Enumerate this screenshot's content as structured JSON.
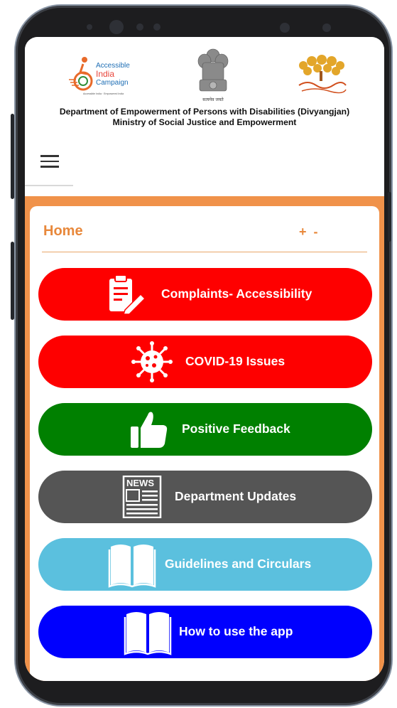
{
  "header": {
    "left_logo_lines": [
      "Accessible",
      "India",
      "Campaign"
    ],
    "left_logo_tagline": "Accessible India · Empowered India",
    "emblem_motto": "सत्यमेव जयते",
    "dept_line1": "Department of Empowerment of Persons with Disabilities (Divyangjan)",
    "dept_line2": "Ministry of Social Justice and Empowerment"
  },
  "home": {
    "title": "Home",
    "zoom_in": "+",
    "zoom_out": "-"
  },
  "menu": [
    {
      "label": "Complaints- Accessibility",
      "color": "#fe0000",
      "icon": "clipboard-pen-icon"
    },
    {
      "label": "COVID-19 Issues",
      "color": "#fe0000",
      "icon": "virus-icon"
    },
    {
      "label": "Positive Feedback",
      "color": "#008000",
      "icon": "thumbs-up-icon"
    },
    {
      "label": "Department Updates",
      "color": "#555555",
      "icon": "newspaper-icon"
    },
    {
      "label": "Guidelines and Circulars",
      "color": "#5bc0de",
      "icon": "open-book-icon"
    },
    {
      "label": "How to use the app",
      "color": "#0000fe",
      "icon": "open-book-icon"
    }
  ],
  "colors": {
    "accent_orange": "#f0924a",
    "home_text": "#e8883b"
  }
}
